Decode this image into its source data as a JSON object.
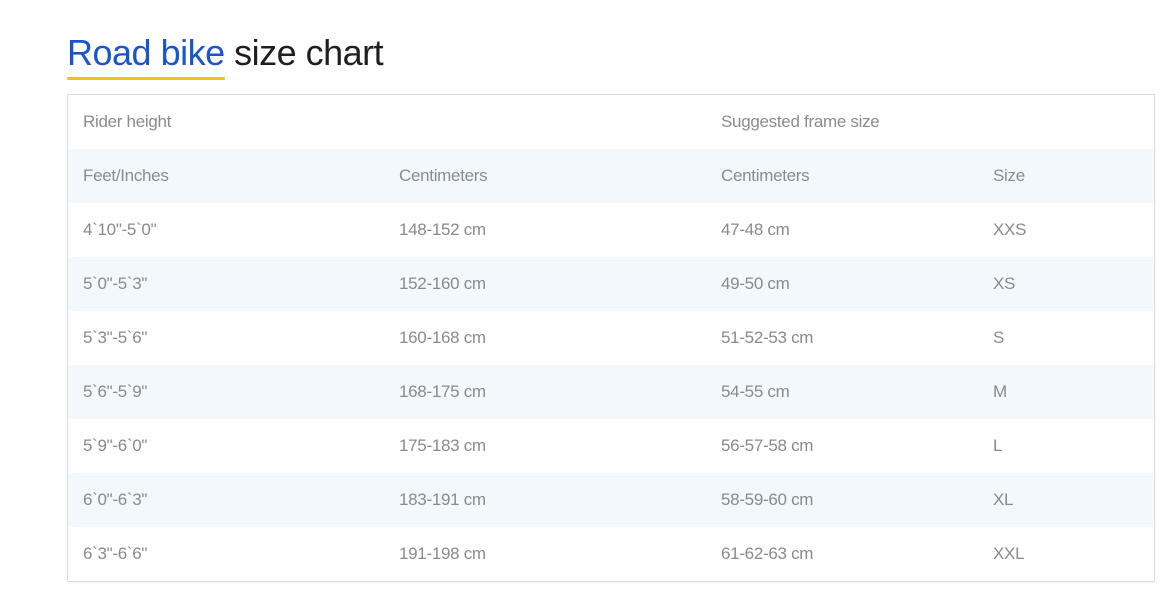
{
  "title": {
    "accent": "Road bike",
    "rest": " size chart"
  },
  "table": {
    "group_headers": {
      "rider_height": "Rider height",
      "frame_size": "Suggested frame size"
    },
    "column_headers": [
      "Feet/Inches",
      "Centimeters",
      "Centimeters",
      "Size"
    ],
    "rows": [
      [
        "4`10\"-5`0\"",
        "148-152 cm",
        "47-48 cm",
        "XXS"
      ],
      [
        "5`0\"-5`3\"",
        "152-160 cm",
        "49-50 cm",
        "XS"
      ],
      [
        "5`3\"-5`6\"",
        "160-168 cm",
        "51-52-53 cm",
        "S"
      ],
      [
        "5`6\"-5`9\"",
        "168-175 cm",
        "54-55 cm",
        "M"
      ],
      [
        "5`9\"-6`0\"",
        "175-183 cm",
        "56-57-58 cm",
        "L"
      ],
      [
        "6`0\"-6`3\"",
        "183-191 cm",
        "58-59-60 cm",
        "XL"
      ],
      [
        "6`3\"-6`6\"",
        "191-198 cm",
        "61-62-63 cm",
        "XXL"
      ]
    ]
  },
  "colors": {
    "accent_blue": "#1a56c9",
    "underline_yellow": "#f2c21b",
    "stripe": "#f3f8fd",
    "text_gray": "#8a8a8a"
  }
}
